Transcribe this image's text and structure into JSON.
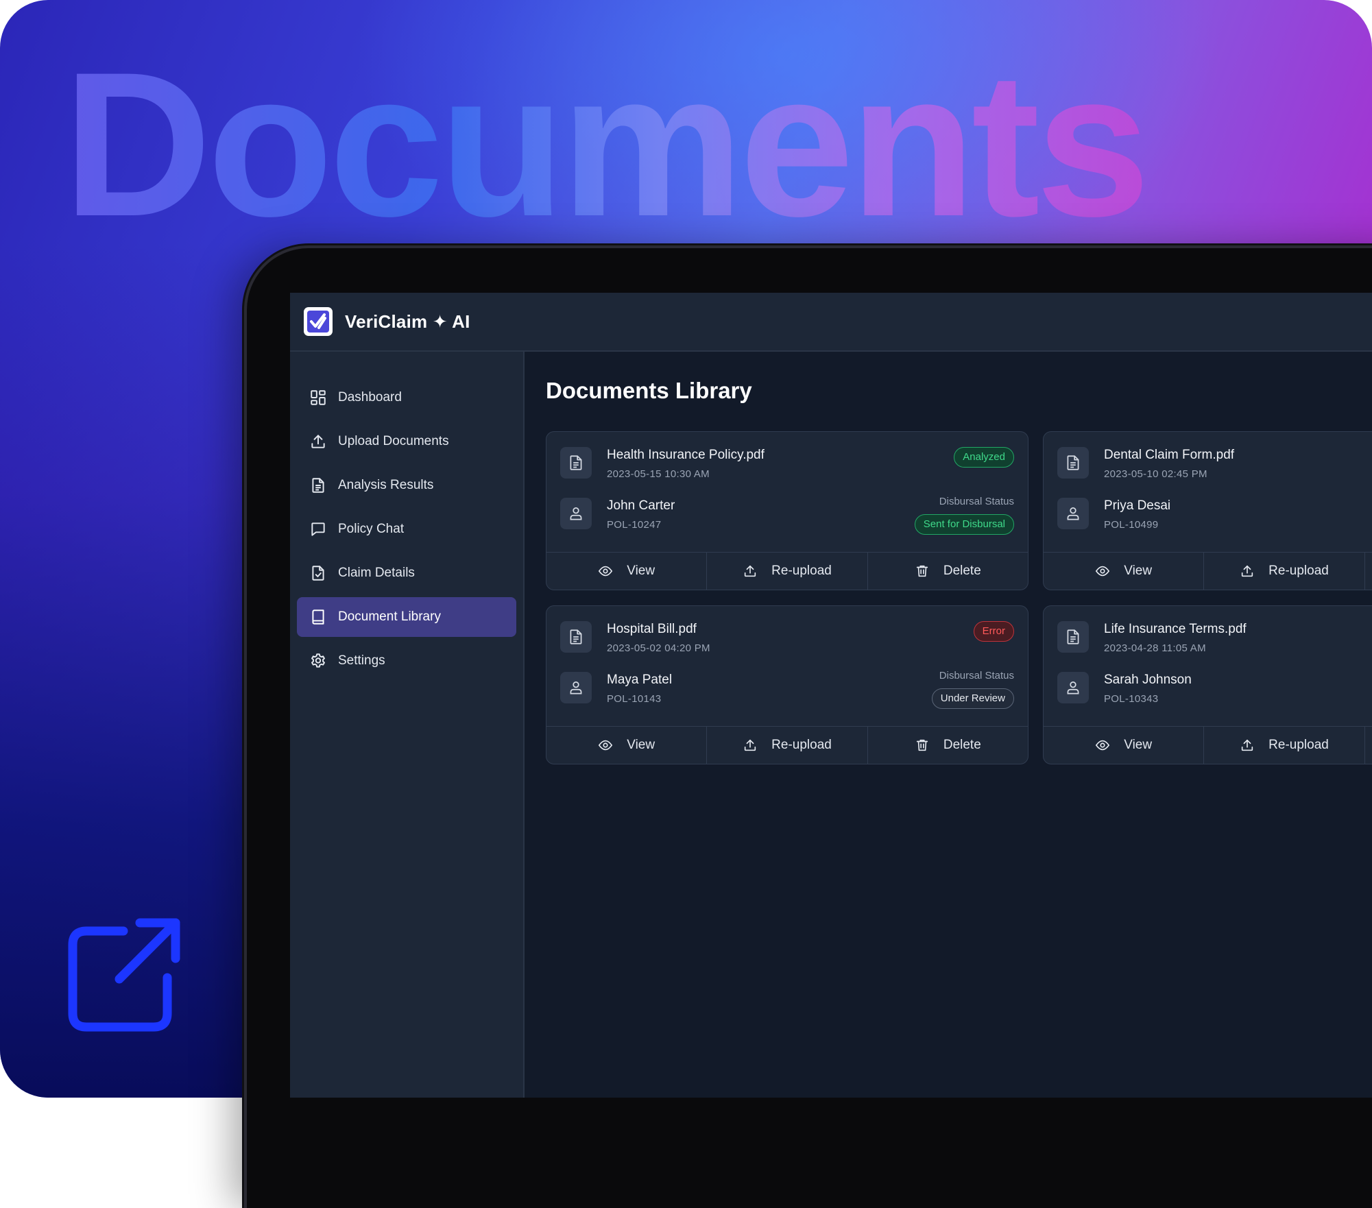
{
  "hero": {
    "word": "Documents"
  },
  "app": {
    "brand": "VeriClaim ✦ AI",
    "nav": [
      {
        "label": "Dashboard",
        "icon": "dashboard-icon"
      },
      {
        "label": "Upload Documents",
        "icon": "upload-icon"
      },
      {
        "label": "Analysis Results",
        "icon": "file-text-icon"
      },
      {
        "label": "Policy Chat",
        "icon": "chat-icon"
      },
      {
        "label": "Claim Details",
        "icon": "file-check-icon"
      },
      {
        "label": "Document Library",
        "icon": "book-icon",
        "active": true
      },
      {
        "label": "Settings",
        "icon": "gear-icon"
      }
    ]
  },
  "library": {
    "title": "Documents Library",
    "disbursal_label": "Disbursal Status",
    "actions": {
      "view": "View",
      "reupload": "Re-upload",
      "delete": "Delete"
    },
    "documents": [
      {
        "name": "Health Insurance Policy.pdf",
        "date": "2023-05-15 10:30 AM",
        "status": "Analyzed",
        "holder": "John Carter",
        "policy": "POL-10247",
        "disbursal": "Sent for Disbursal"
      },
      {
        "name": "Dental Claim Form.pdf",
        "date": "2023-05-10 02:45 PM",
        "holder": "Priya Desai",
        "policy": "POL-10499"
      },
      {
        "name": "Hospital Bill.pdf",
        "date": "2023-05-02 04:20 PM",
        "status": "Error",
        "holder": "Maya Patel",
        "policy": "POL-10143",
        "disbursal": "Under Review"
      },
      {
        "name": "Life Insurance Terms.pdf",
        "date": "2023-04-28 11:05 AM",
        "holder": "Sarah Johnson",
        "policy": "POL-10343"
      }
    ]
  },
  "colors": {
    "accent_active": "#3f3d86",
    "status_green": "#3fd98a",
    "status_red": "#ff5a5a",
    "screen_bg": "#121a29",
    "panel_bg": "#1d2737"
  }
}
